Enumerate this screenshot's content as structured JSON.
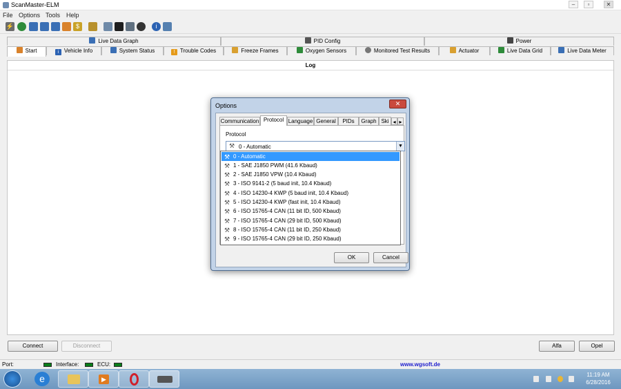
{
  "app": {
    "title": "ScanMaster-ELM"
  },
  "window_controls": {
    "minimize": "–",
    "maximize": "▫",
    "close": "✕"
  },
  "menu": [
    "File",
    "Options",
    "Tools",
    "Help"
  ],
  "tabs_top": [
    "Live Data Graph",
    "PID Config",
    "Power"
  ],
  "tabs_bottom": [
    "Start",
    "Vehicle Info",
    "System Status",
    "Trouble Codes",
    "Freeze Frames",
    "Oxygen Sensors",
    "Monitored Test Results",
    "Actuator",
    "Live Data Grid",
    "Live Data Meter"
  ],
  "log": {
    "title": "Log"
  },
  "buttons": {
    "connect": "Connect",
    "disconnect": "Disconnect",
    "alfa": "Alfa",
    "opel": "Opel"
  },
  "status": {
    "port": "Port:",
    "interface": "Interface:",
    "ecu": "ECU:",
    "url": "www.wgsoft.de"
  },
  "clock": {
    "time": "11:19 AM",
    "date": "6/28/2016"
  },
  "dialog": {
    "title": "Options",
    "close": "✕",
    "tabs": [
      "Communication",
      "Protocol",
      "Language",
      "General",
      "PIDs",
      "Graph",
      "Ski"
    ],
    "scroll_left": "◂",
    "scroll_right": "▸",
    "protocol_label": "Protocol",
    "selected_protocol": "0 - Automatic",
    "options": [
      "0 - Automatic",
      "1 - SAE J1850 PWM (41.6 Kbaud)",
      "2 - SAE J1850 VPW (10.4 Kbaud)",
      "3 - ISO 9141-2 (5 baud init, 10.4 Kbaud)",
      "4 - ISO 14230-4 KWP (5 baud init, 10.4 Kbaud)",
      "5 - ISO 14230-4 KWP (fast init, 10.4 Kbaud)",
      "6 - ISO 15765-4 CAN (11 bit ID, 500 Kbaud)",
      "7 - ISO 15765-4 CAN (29 bit ID, 500 Kbaud)",
      "8 - ISO 15765-4 CAN (11 bit ID, 250 Kbaud)",
      "9 - ISO 15765-4 CAN (29 bit ID, 250 Kbaud)"
    ],
    "ok": "OK",
    "cancel": "Cancel"
  },
  "colors": {
    "accent": "#3399ff",
    "led": "#0a7e1a",
    "url": "#1c1ccd"
  }
}
